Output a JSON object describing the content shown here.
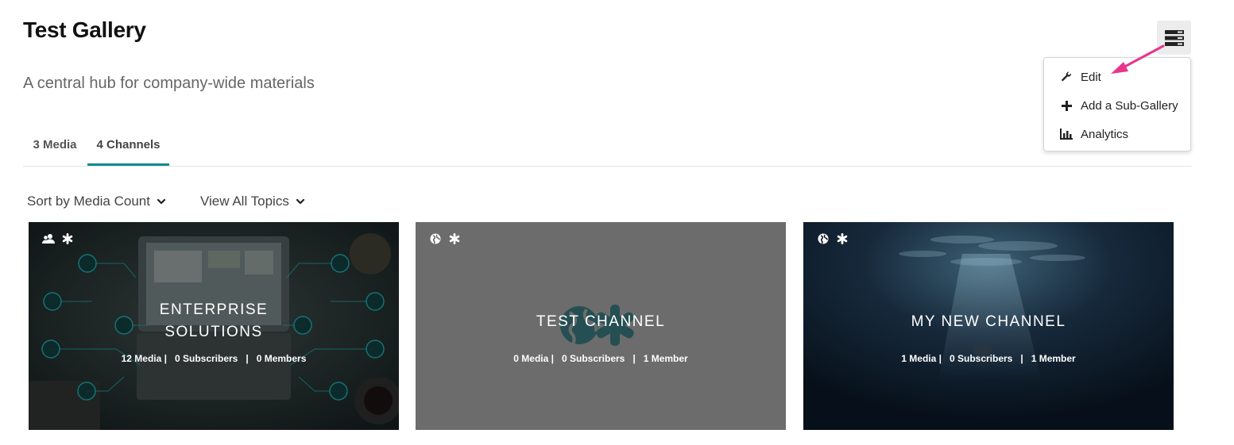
{
  "header": {
    "title": "Test Gallery",
    "description": "A central hub for company-wide materials"
  },
  "tabs": [
    {
      "label": "3 Media",
      "active": false
    },
    {
      "label": "4 Channels",
      "active": true
    }
  ],
  "filters": {
    "sort_label": "Sort by Media Count",
    "topics_label": "View All Topics"
  },
  "actions_menu": {
    "button_icon": "menu-lines-icon",
    "items": [
      {
        "label": "Edit",
        "icon": "wrench-icon"
      },
      {
        "label": "Add a Sub-Gallery",
        "icon": "plus-icon"
      },
      {
        "label": "Analytics",
        "icon": "bar-chart-icon"
      }
    ]
  },
  "accent_color": "#138a8f",
  "arrow_color": "#e8358d",
  "channels": [
    {
      "title_line1": "ENTERPRISE",
      "title_line2": "SOLUTIONS",
      "stats": "12 Media |   0 Subscribers   |   0 Members",
      "badges": [
        "users-icon",
        "asterisk-icon"
      ]
    },
    {
      "title_line1": "TEST CHANNEL",
      "stats": "0 Media |   0 Subscribers   |   1 Member",
      "badges": [
        "globe-icon",
        "asterisk-icon"
      ]
    },
    {
      "title_line1": "MY NEW CHANNEL",
      "stats": "1 Media |   0 Subscribers   |   1 Member",
      "badges": [
        "globe-icon",
        "asterisk-icon"
      ]
    }
  ]
}
